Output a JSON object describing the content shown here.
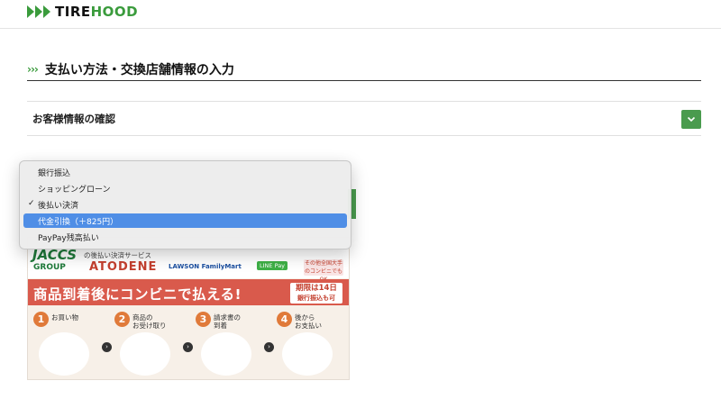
{
  "header": {
    "logo_tire": "TIRE",
    "logo_hood": "HOOD"
  },
  "section": {
    "title": "支払い方法・交換店舗情報の入力"
  },
  "confirm": {
    "label": "お客様情報の確認"
  },
  "dropdown": {
    "options": [
      {
        "label": "銀行振込",
        "checked": false,
        "highlighted": false
      },
      {
        "label": "ショッピングローン",
        "checked": false,
        "highlighted": false
      },
      {
        "label": "後払い決済",
        "checked": true,
        "highlighted": false
      },
      {
        "label": "代金引換（＋825円）",
        "checked": false,
        "highlighted": true
      },
      {
        "label": "PayPay残高払い",
        "checked": false,
        "highlighted": false
      }
    ]
  },
  "banner": {
    "jaccs": "JACCS",
    "jaccs_group": "GROUP",
    "service_label": "の後払い決済サービス",
    "atodene": "ATODENE",
    "stores": "LAWSON  FamilyMart",
    "line_pay": "LINE Pay",
    "conv_ok": "その他全国大手のコンビニでもOK",
    "headline": "商品到着後にコンビニで払える!",
    "period_1": "期限は14日",
    "period_2": "銀行振込も可",
    "steps": [
      {
        "num": "1",
        "text": "お買い物"
      },
      {
        "num": "2",
        "text": "商品の\nお受け取り"
      },
      {
        "num": "3",
        "text": "請求書の\n到着"
      },
      {
        "num": "4",
        "text": "後から\nお支払い"
      }
    ]
  },
  "colors": {
    "brand_green": "#3a9b3c",
    "accent_red": "#d95a4c",
    "selection_blue": "#4f8ee6"
  }
}
